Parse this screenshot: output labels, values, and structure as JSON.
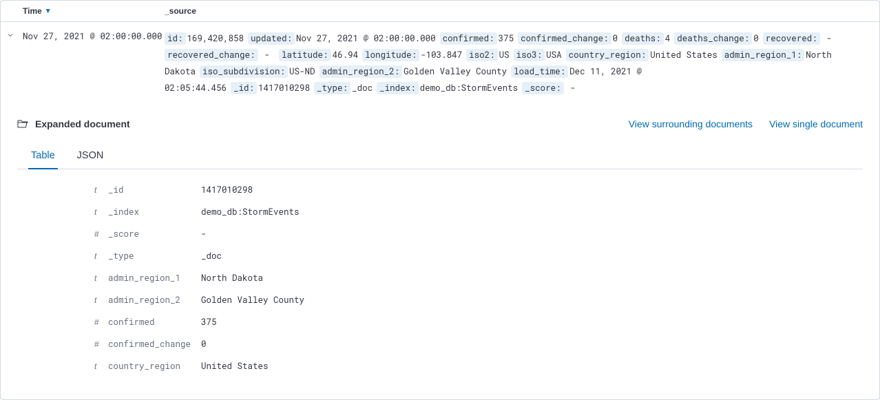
{
  "header": {
    "time_label": "Time",
    "source_label": "_source"
  },
  "row": {
    "timestamp": "Nov 27, 2021 @ 02:00:00.000",
    "source_fields": [
      {
        "k": "id:",
        "v": "169,420,858"
      },
      {
        "k": "updated:",
        "v": "Nov 27, 2021 @ 02:00:00.000"
      },
      {
        "k": "confirmed:",
        "v": "375"
      },
      {
        "k": "confirmed_change:",
        "v": "0"
      },
      {
        "k": "deaths:",
        "v": "4"
      },
      {
        "k": "deaths_change:",
        "v": "0"
      },
      {
        "k": "recovered:",
        "v": " - "
      },
      {
        "k": "recovered_change:",
        "v": " - "
      },
      {
        "k": "latitude:",
        "v": "46.94"
      },
      {
        "k": "longitude:",
        "v": "-103.847"
      },
      {
        "k": "iso2:",
        "v": "US"
      },
      {
        "k": "iso3:",
        "v": "USA"
      },
      {
        "k": "country_region:",
        "v": "United States"
      },
      {
        "k": "admin_region_1:",
        "v": "North Dakota"
      },
      {
        "k": "iso_subdivision:",
        "v": "US-ND"
      },
      {
        "k": "admin_region_2:",
        "v": "Golden Valley County"
      },
      {
        "k": "load_time:",
        "v": "Dec 11, 2021 @ 02:05:44.456"
      },
      {
        "k": "_id:",
        "v": "1417010298"
      },
      {
        "k": "_type:",
        "v": "_doc"
      },
      {
        "k": "_index:",
        "v": "demo_db:StormEvents"
      },
      {
        "k": "_score:",
        "v": " - "
      }
    ]
  },
  "expanded": {
    "title": "Expanded document",
    "link_surrounding": "View surrounding documents",
    "link_single": "View single document",
    "tabs": {
      "table": "Table",
      "json": "JSON"
    },
    "fields": [
      {
        "type": "t",
        "name": "_id",
        "value": "1417010298"
      },
      {
        "type": "t",
        "name": "_index",
        "value": "demo_db:StormEvents"
      },
      {
        "type": "#",
        "name": "_score",
        "value": " - "
      },
      {
        "type": "t",
        "name": "_type",
        "value": "_doc"
      },
      {
        "type": "t",
        "name": "admin_region_1",
        "value": "North Dakota"
      },
      {
        "type": "t",
        "name": "admin_region_2",
        "value": "Golden Valley County"
      },
      {
        "type": "#",
        "name": "confirmed",
        "value": "375"
      },
      {
        "type": "#",
        "name": "confirmed_change",
        "value": "0"
      },
      {
        "type": "t",
        "name": "country_region",
        "value": "United States"
      }
    ]
  }
}
